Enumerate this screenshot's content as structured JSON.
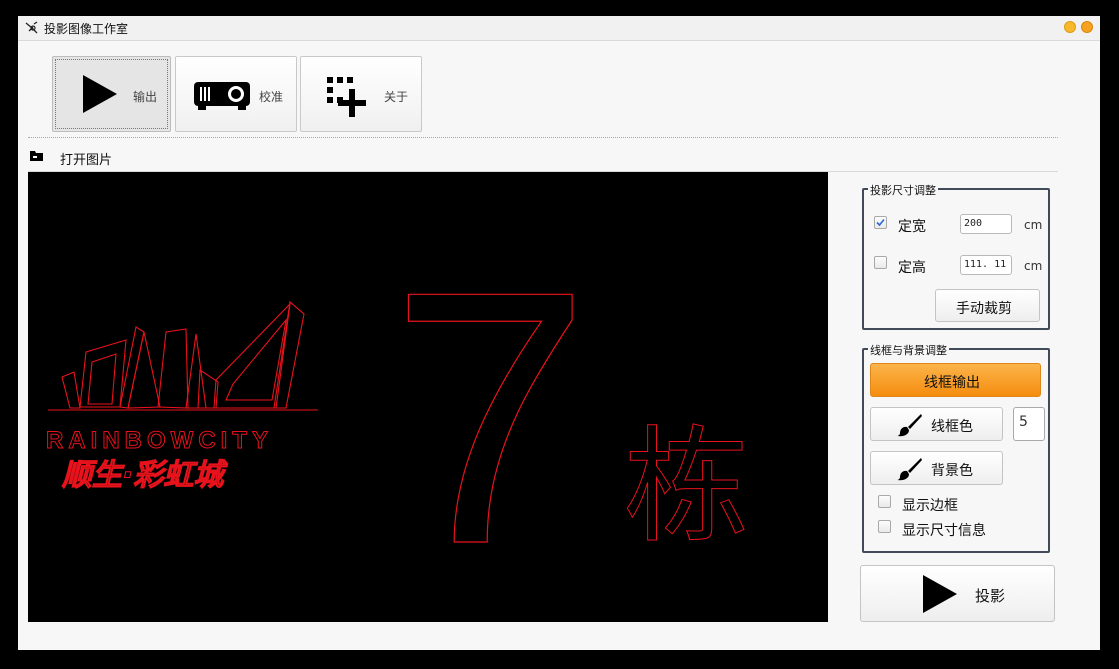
{
  "window": {
    "title": "投影图像工作室"
  },
  "toolbar": {
    "output_label": "输出",
    "calibrate_label": "校准",
    "about_label": "关于"
  },
  "file": {
    "open_image_label": "打开图片"
  },
  "canvas_image": {
    "logo_en": "RAINBOWCITY",
    "logo_cn": "顺生·彩虹城",
    "building_number": "7",
    "building_unit": "栋",
    "line_color": "#e8121c"
  },
  "size_group": {
    "title": "投影尺寸调整",
    "fixed_width_label": "定宽",
    "fixed_width_checked": true,
    "width_value": "200",
    "width_unit": "cm",
    "fixed_height_label": "定高",
    "fixed_height_checked": false,
    "height_value": "111. 11",
    "height_unit": "cm",
    "manual_crop_label": "手动裁剪"
  },
  "frame_group": {
    "title": "线框与背景调整",
    "wireframe_output_label": "线框输出",
    "line_color_label": "线框色",
    "line_width_value": "5",
    "bg_color_label": "背景色",
    "show_border_label": "显示边框",
    "show_border_checked": false,
    "show_size_info_label": "显示尺寸信息",
    "show_size_info_checked": false
  },
  "project": {
    "label": "投影"
  },
  "colors": {
    "accent_orange": "#f79a1e",
    "group_border": "#404a58"
  }
}
